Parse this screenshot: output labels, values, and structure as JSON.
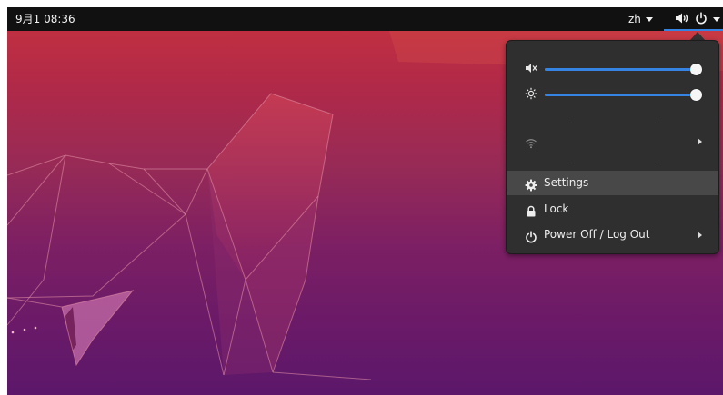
{
  "topbar": {
    "clock": "9月1 08:36",
    "language": "zh",
    "icons": [
      "speaker-icon",
      "power-icon",
      "chevron-down-icon"
    ]
  },
  "system_menu": {
    "volume": {
      "icon": "speaker-muted-icon",
      "level": 1.0
    },
    "brightness": {
      "icon": "brightness-icon",
      "level": 1.0
    },
    "wifi": {
      "icon": "wifi-icon",
      "label": ""
    },
    "items": [
      {
        "icon": "gear-icon",
        "label": "Settings"
      },
      {
        "icon": "lock-icon",
        "label": "Lock"
      },
      {
        "icon": "power-icon",
        "label": "Power Off / Log Out"
      }
    ]
  },
  "colors": {
    "topbar": "#111111",
    "menu_bg": "#2f2f2f",
    "accent": "#3584e4",
    "hover": "#484848"
  }
}
